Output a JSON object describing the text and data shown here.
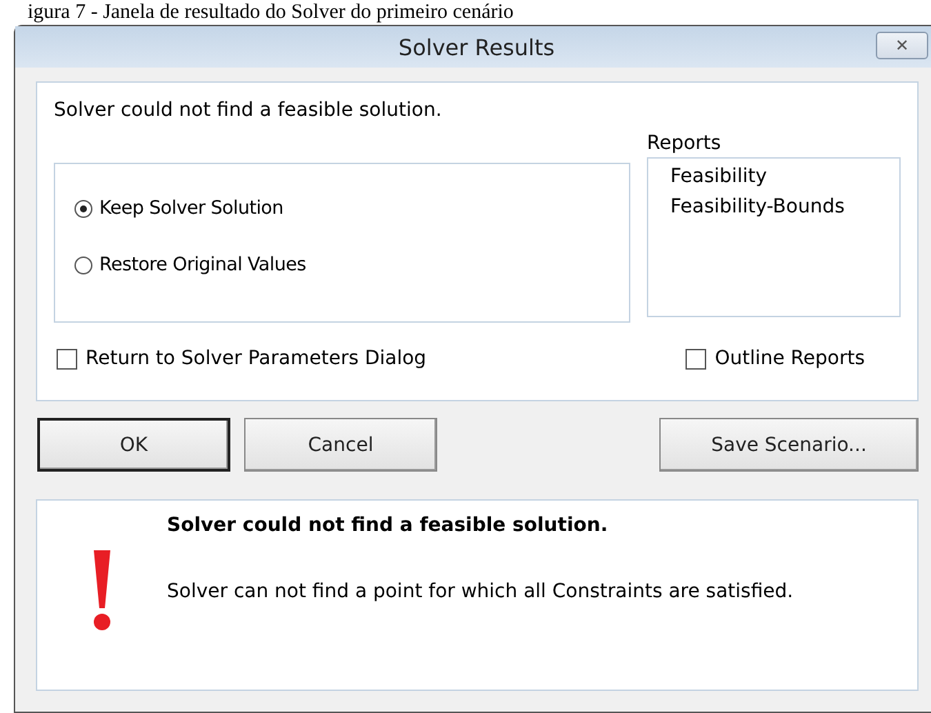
{
  "caption": "igura 7 - Janela de resultado do Solver do primeiro cenário",
  "window": {
    "title": "Solver Results",
    "close": "✕"
  },
  "message": "Solver could not find a feasible solution.",
  "options": [
    {
      "label": "Keep Solver Solution",
      "selected": true
    },
    {
      "label": "Restore Original Values",
      "selected": false
    }
  ],
  "reports": {
    "label": "Reports",
    "items": [
      "Feasibility",
      "Feasibility-Bounds"
    ]
  },
  "return_checkbox": {
    "label": "Return to Solver Parameters Dialog",
    "checked": false
  },
  "outline_checkbox": {
    "label": "Outline Reports",
    "checked": false
  },
  "buttons": [
    {
      "label": "OK",
      "kind": "default"
    },
    {
      "label": "Cancel",
      "kind": "normal"
    },
    {
      "label": "Save Scenario...",
      "kind": "right"
    }
  ],
  "detail": {
    "heading": "Solver could not find a feasible solution.",
    "text": "Solver can not find a point for which all Constraints are satisfied."
  }
}
